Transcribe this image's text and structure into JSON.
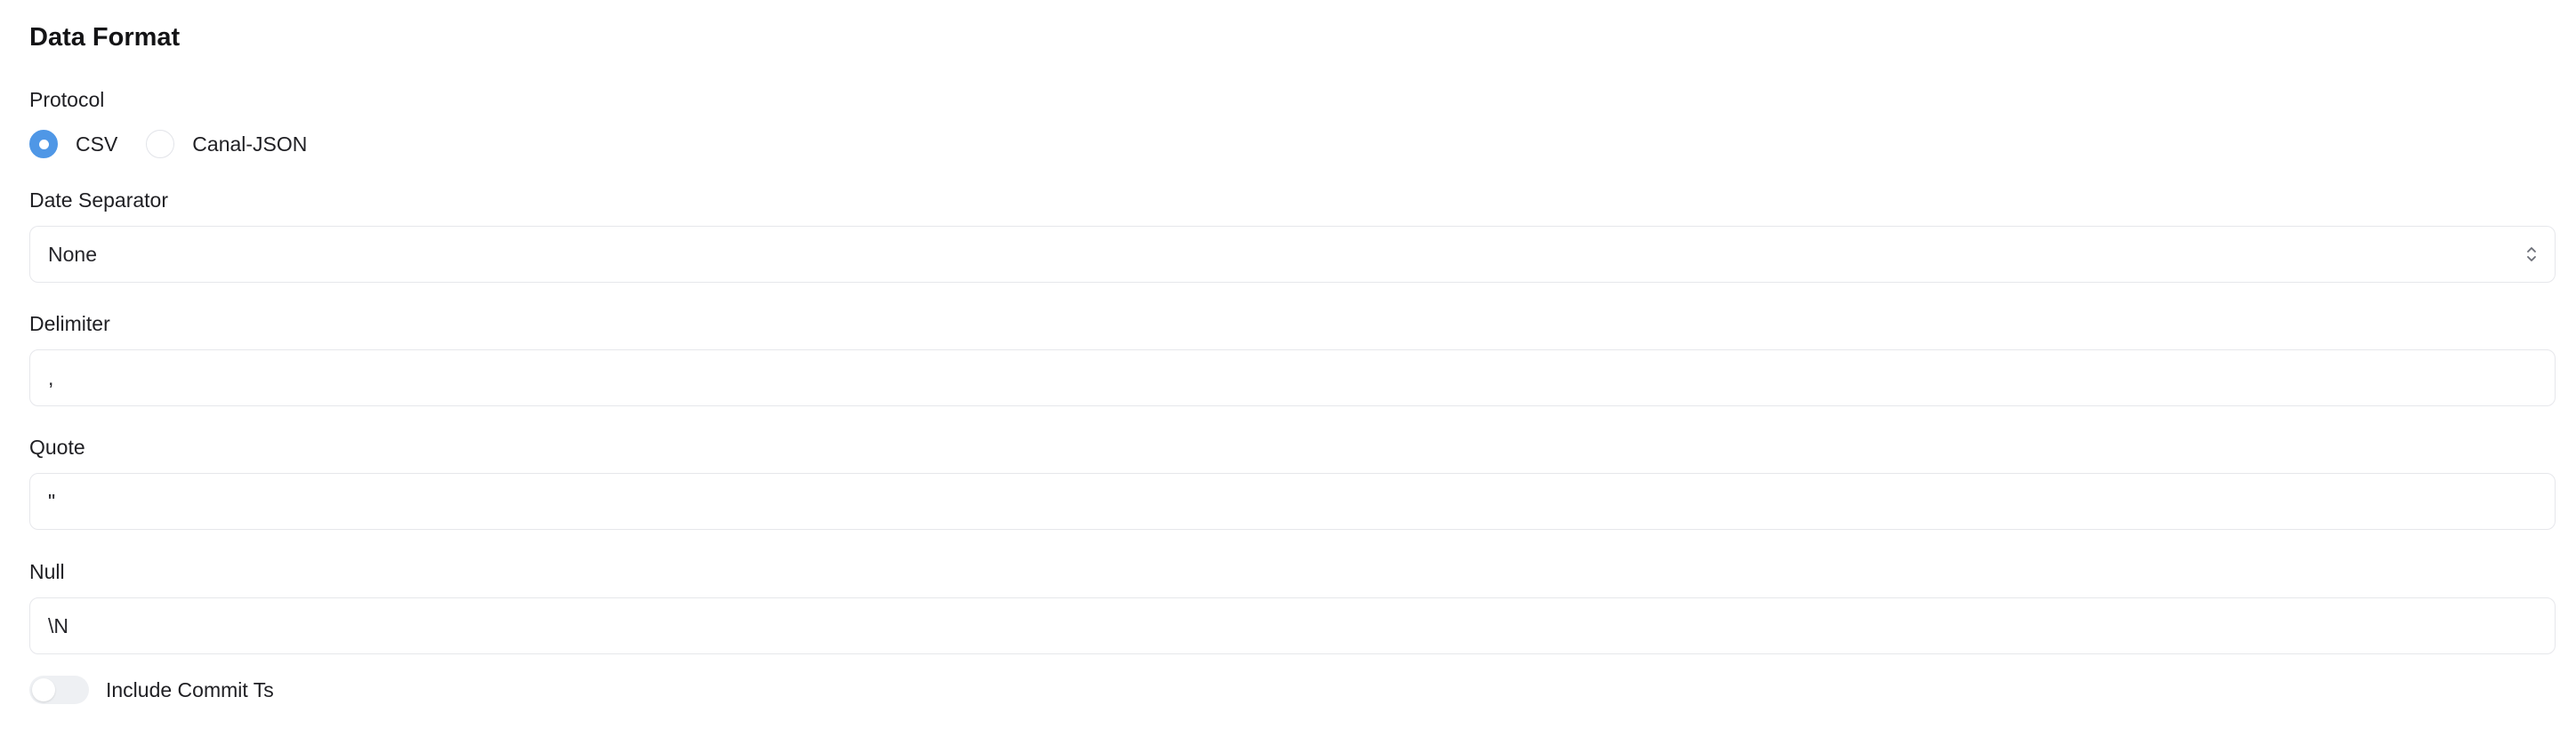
{
  "section": {
    "title": "Data Format"
  },
  "protocol": {
    "label": "Protocol",
    "options": [
      {
        "label": "CSV",
        "selected": true
      },
      {
        "label": "Canal-JSON",
        "selected": false
      }
    ]
  },
  "date_separator": {
    "label": "Date Separator",
    "value": "None",
    "icon": "chevron-up-down-icon"
  },
  "delimiter": {
    "label": "Delimiter",
    "value": ","
  },
  "quote": {
    "label": "Quote",
    "value": "\""
  },
  "null_field": {
    "label": "Null",
    "value": "\\N"
  },
  "include_commit_ts": {
    "label": "Include Commit Ts",
    "enabled": false
  },
  "colors": {
    "accent": "#4f97e6",
    "border": "#e6e7eb",
    "toggle_off": "#eef0f3"
  }
}
